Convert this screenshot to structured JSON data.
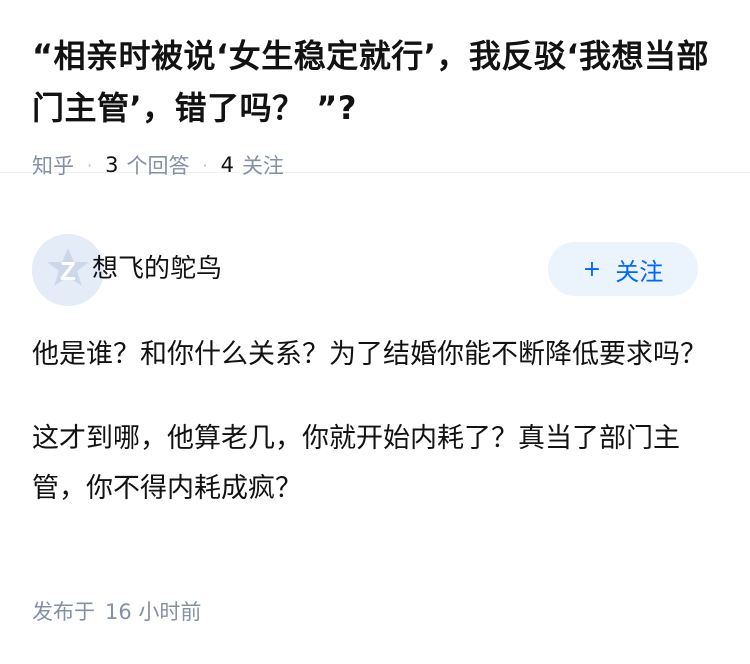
{
  "question": {
    "title": "“相亲时被说‘女生稳定就行’，我反驳‘我想当部门主管’，错了吗？ ”?",
    "source": "知乎",
    "answer_count": "3",
    "answer_label": "个回答",
    "follow_count": "4",
    "follow_label": "关注"
  },
  "answer": {
    "author_name": "想飞的鸵鸟",
    "avatar_icon": "default-avatar-z-icon",
    "follow_button": "关注",
    "follow_button_icon": "plus-icon",
    "paragraphs": [
      "他是谁？和你什么关系？为了结婚你能不断降低要求吗？",
      "这才到哪，他算老几，你就开始内耗了？真当了部门主管，你不得内耗成疯？"
    ],
    "posted_label": "发布于",
    "posted_time": "16 小时前"
  },
  "colors": {
    "accent": "#0066ff",
    "button_bg": "#ebf3fc",
    "meta_text": "#8590a6",
    "avatar_bg": "#e4ecf7"
  }
}
